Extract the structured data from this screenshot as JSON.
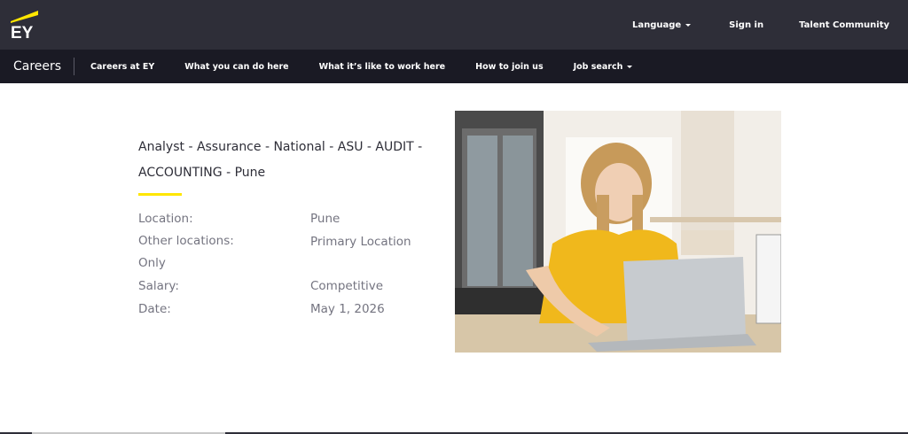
{
  "brand": {
    "logo_text": "EY",
    "accent_color": "#ffe600",
    "dark_color": "#2e2e38"
  },
  "top_nav": {
    "language": "Language",
    "sign_in": "Sign in",
    "talent_community": "Talent Community"
  },
  "sub_nav": {
    "careers": "Careers",
    "items": [
      "Careers at EY",
      "What you can do here",
      "What it’s like to work here",
      "How to join us",
      "Job search"
    ]
  },
  "job": {
    "title": "Analyst - Assurance - National - ASU - AUDIT - ACCOUNTING - Pune",
    "location_label": "Location:",
    "location_value": "Pune",
    "other_locations_label_1": "Other locations:",
    "other_locations_label_2": "Only",
    "other_locations_value": "Primary Location",
    "salary_label": "Salary:",
    "salary_value": "Competitive",
    "date_label": "Date:",
    "date_value": "May 1, 2026"
  }
}
